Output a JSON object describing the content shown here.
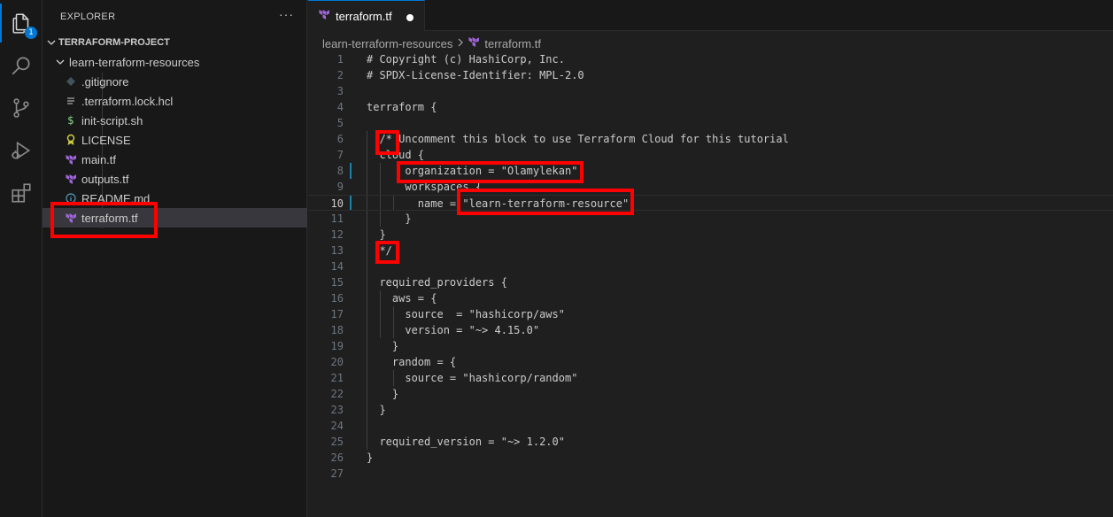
{
  "activity_bar": {
    "items": [
      {
        "name": "explorer-icon",
        "active": true
      },
      {
        "name": "search-icon",
        "active": false
      },
      {
        "name": "source-control-icon",
        "active": false
      },
      {
        "name": "run-debug-icon",
        "active": false
      },
      {
        "name": "extensions-icon",
        "active": false
      }
    ],
    "explorer_badge": "1"
  },
  "sidebar": {
    "title": "EXPLORER",
    "more": "···",
    "project": "TERRAFORM-PROJECT",
    "folder": "learn-terraform-resources",
    "files": [
      {
        "name": ".gitignore",
        "icon": "gitignore-icon",
        "selected": false
      },
      {
        "name": ".terraform.lock.hcl",
        "icon": "lines-file-icon",
        "selected": false
      },
      {
        "name": "init-script.sh",
        "icon": "shell-dollar-icon",
        "selected": false
      },
      {
        "name": "LICENSE",
        "icon": "license-icon",
        "selected": false
      },
      {
        "name": "main.tf",
        "icon": "terraform-icon",
        "selected": false
      },
      {
        "name": "outputs.tf",
        "icon": "terraform-icon",
        "selected": false
      },
      {
        "name": "README.md",
        "icon": "info-icon",
        "selected": false
      },
      {
        "name": "terraform.tf",
        "icon": "terraform-icon",
        "selected": true
      }
    ]
  },
  "tab": {
    "label": "terraform.tf",
    "icon": "terraform-icon",
    "modified": true
  },
  "breadcrumb": {
    "folder": "learn-terraform-resources",
    "file": "terraform.tf"
  },
  "editor": {
    "current_line": 10,
    "lines": [
      "# Copyright (c) HashiCorp, Inc.",
      "# SPDX-License-Identifier: MPL-2.0",
      "",
      "terraform {",
      "",
      "  /* Uncomment this block to use Terraform Cloud for this tutorial",
      "  cloud {",
      "      organization = \"Olamylekan\"",
      "      workspaces {",
      "        name = \"learn-terraform-resource\"",
      "      }",
      "  }",
      "  */",
      "",
      "  required_providers {",
      "    aws = {",
      "      source  = \"hashicorp/aws\"",
      "      version = \"~> 4.15.0\"",
      "    }",
      "    random = {",
      "      source = \"hashicorp/random\"",
      "    }",
      "  }",
      "",
      "  required_version = \"~> 1.2.0\"",
      "}",
      ""
    ]
  },
  "colors": {
    "accent": "#0078d4",
    "terraform_purple": "#a066d9",
    "annotation_red": "#ff0000"
  }
}
